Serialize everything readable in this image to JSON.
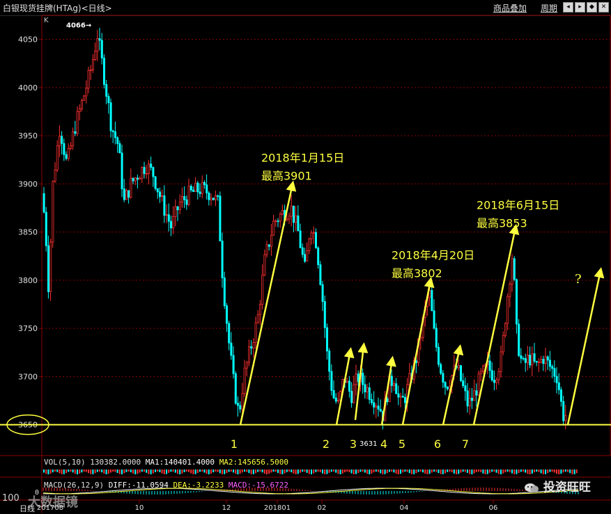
{
  "header": {
    "title": "白银现货挂牌(HTAg)<日线>",
    "buttons": [
      "商品叠加",
      "周期"
    ],
    "window_buttons": [
      "arrow-left-icon",
      "arrow-right-icon",
      "arrow-both-icon",
      "close-icon"
    ]
  },
  "panel_label": "K",
  "chart_data": {
    "type": "candlestick",
    "title": "白银现货挂牌(HTAg)<日线>",
    "y_ticks": [
      "4050",
      "4000",
      "3950",
      "3900",
      "3850",
      "3800",
      "3750",
      "3700",
      "3650"
    ],
    "ylim": [
      3618,
      4075
    ],
    "x_ticks": [
      "201708",
      "10",
      "12",
      "201801",
      "02",
      "04",
      "06"
    ],
    "peak_label": "4066",
    "support_level": 3650,
    "annotations": [
      {
        "line1": "2018年1月15日",
        "line2": "最高3901"
      },
      {
        "line1": "2018年4月20日",
        "line2": "最高3802"
      },
      {
        "line1": "2018年6月15日",
        "line2": "最高3853"
      }
    ],
    "numbers": [
      "1",
      "2",
      "3",
      "4",
      "5",
      "6",
      "7"
    ],
    "low_label": "3631",
    "question_mark": "?",
    "colors": {
      "up": "#ff3030",
      "down": "#00ffff",
      "support": "#ffff40",
      "annotation": "#ffff40",
      "grid": "#8b0000"
    }
  },
  "volume": {
    "label": "VOL(5,10)",
    "value": "130382.0000",
    "ma1": "MA1:140401.4000",
    "ma2": "MA2:145656.5000"
  },
  "macd": {
    "label": "MACD(26,12,9)",
    "diff": "DIFF:-11.0594",
    "dea": "DEA:-3.2233",
    "macd": "MACD:-15.6722",
    "zero": "0"
  },
  "footer_label": "日线",
  "watermark": {
    "camera_text": "100",
    "brand_text": "大数据镜",
    "channel": "投资旺旺"
  }
}
